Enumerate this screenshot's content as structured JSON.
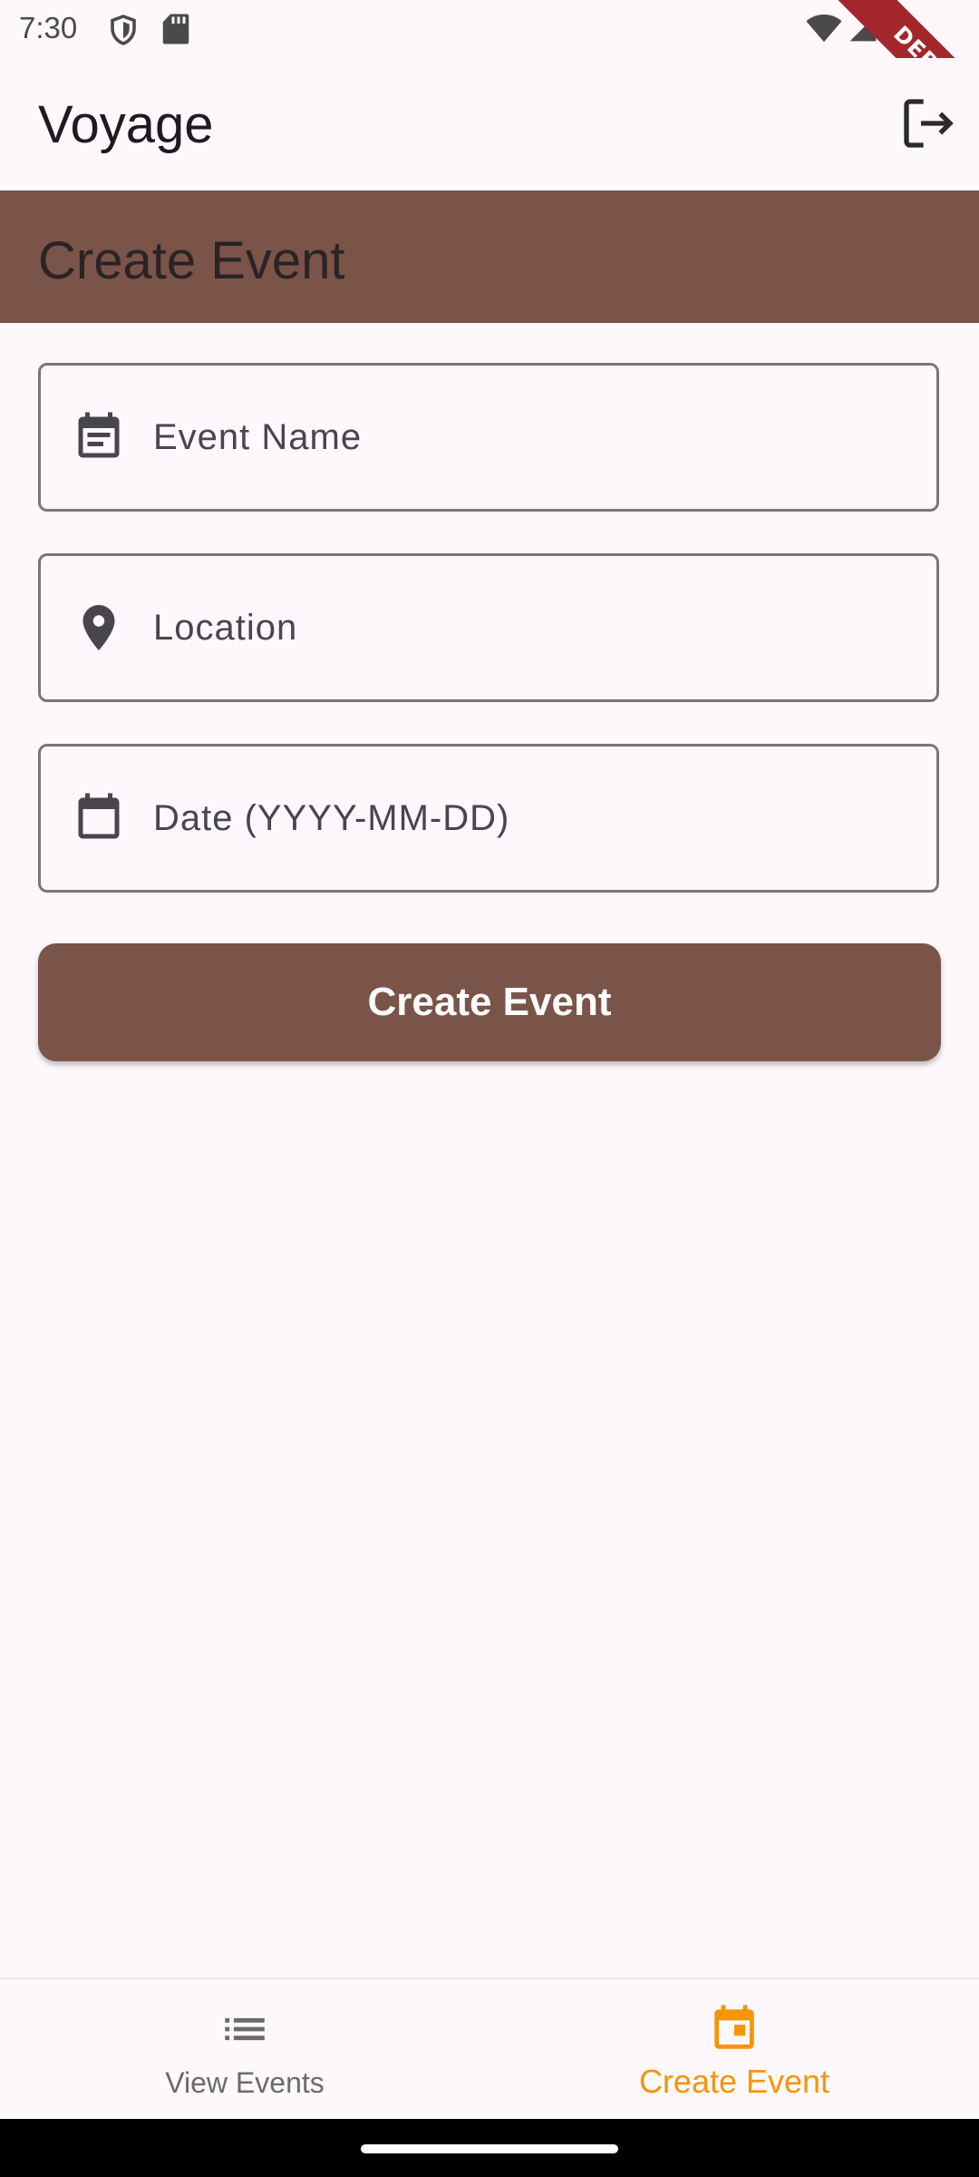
{
  "status_bar": {
    "time": "7:30",
    "icons": [
      "shield-icon",
      "sd-card-icon",
      "wifi-icon",
      "signal-icon"
    ],
    "debug_label": "DEBUG"
  },
  "app_bar": {
    "title": "Voyage",
    "action_icon": "logout-icon"
  },
  "header": {
    "title": "Create Event",
    "background": "#7a5449"
  },
  "form": {
    "fields": [
      {
        "icon": "event-note-icon",
        "placeholder": "Event Name",
        "value": ""
      },
      {
        "icon": "location-pin-icon",
        "placeholder": "Location",
        "value": ""
      },
      {
        "icon": "calendar-icon",
        "placeholder": "Date (YYYY-MM-DD)",
        "value": ""
      }
    ],
    "submit_label": "Create Event"
  },
  "bottom_nav": {
    "items": [
      {
        "label": "View Events",
        "icon": "list-icon",
        "active": false
      },
      {
        "label": "Create Event",
        "icon": "calendar-today-icon",
        "active": true
      }
    ],
    "active_color": "#f5950a",
    "inactive_color": "#6b6b6b"
  }
}
